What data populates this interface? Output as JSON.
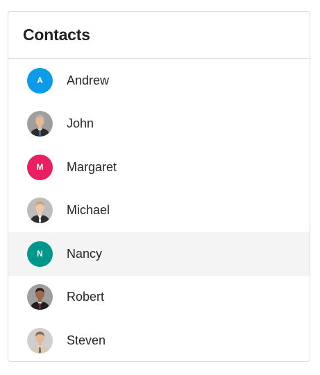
{
  "header": {
    "title": "Contacts"
  },
  "contacts": [
    {
      "name": "Andrew",
      "avatar_type": "initial",
      "initial": "A",
      "color": "#0b9be8"
    },
    {
      "name": "John",
      "avatar_type": "photo",
      "initial": "",
      "color": "#9e9e9e",
      "suit": "#2b2b2b",
      "tie": "#3a6fb0",
      "hair": "#b7b2ab",
      "skin": "#e6b996"
    },
    {
      "name": "Margaret",
      "avatar_type": "initial",
      "initial": "M",
      "color": "#e91e63"
    },
    {
      "name": "Michael",
      "avatar_type": "photo",
      "initial": "",
      "color": "#bdbdbd",
      "suit": "#2e2e2e",
      "tie": "#ffffff",
      "hair": "#c9a46a",
      "skin": "#efc7a8"
    },
    {
      "name": "Nancy",
      "avatar_type": "initial",
      "initial": "N",
      "color": "#00968a",
      "active": true
    },
    {
      "name": "Robert",
      "avatar_type": "photo",
      "initial": "",
      "color": "#9e9e9e",
      "suit": "#1f1f1f",
      "tie": "#8b2a2a",
      "hair": "#2a1a10",
      "skin": "#9c6a47"
    },
    {
      "name": "Steven",
      "avatar_type": "photo",
      "initial": "",
      "color": "#cfcfcf",
      "suit": "#d8cbb5",
      "tie": "#6b5b4a",
      "hair": "#8a6a4a",
      "skin": "#e6b996"
    }
  ]
}
